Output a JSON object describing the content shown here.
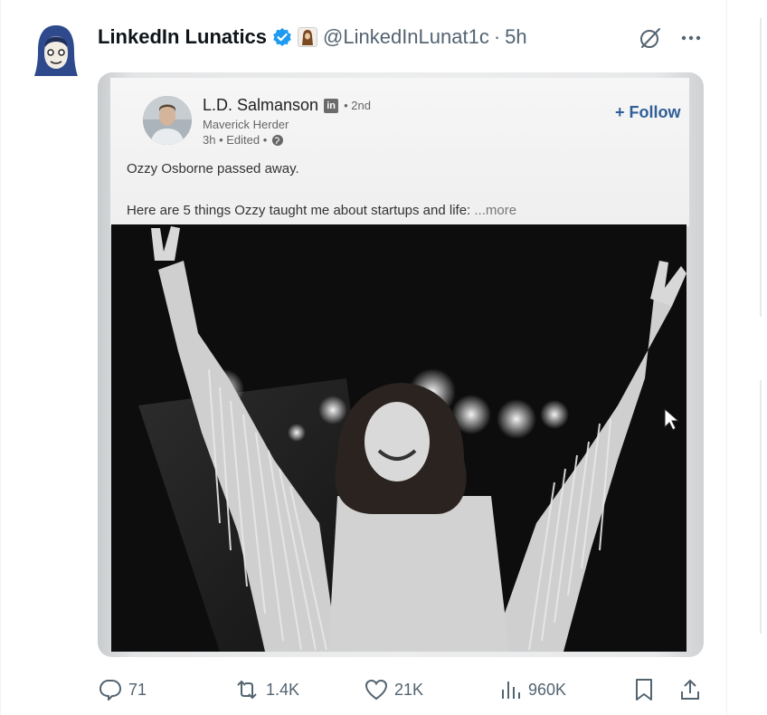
{
  "tweet": {
    "author_name": "LinkedIn Lunatics",
    "handle": "@LinkedInLunat1c",
    "separator": "·",
    "time": "5h",
    "icons": {
      "verified": "verified-badge-icon",
      "grok": "grok-icon",
      "more": "more-icon"
    },
    "colors": {
      "verified": "#1d9bf0",
      "text": "#0f1419",
      "muted": "#536471"
    }
  },
  "linkedin_post": {
    "name": "L.D. Salmanson",
    "badge": "in",
    "degree": "• 2nd",
    "headline": "Maverick Herder",
    "meta": "3h • Edited •",
    "follow": "+ Follow",
    "text_line1": "Ozzy Osborne passed away.",
    "text_line2": "Here are 5 things Ozzy taught me about startups and life:",
    "more": "...more",
    "colors": {
      "follow": "#2f5f98"
    }
  },
  "actions": {
    "replies": "71",
    "reposts": "1.4K",
    "likes": "21K",
    "views": "960K"
  }
}
